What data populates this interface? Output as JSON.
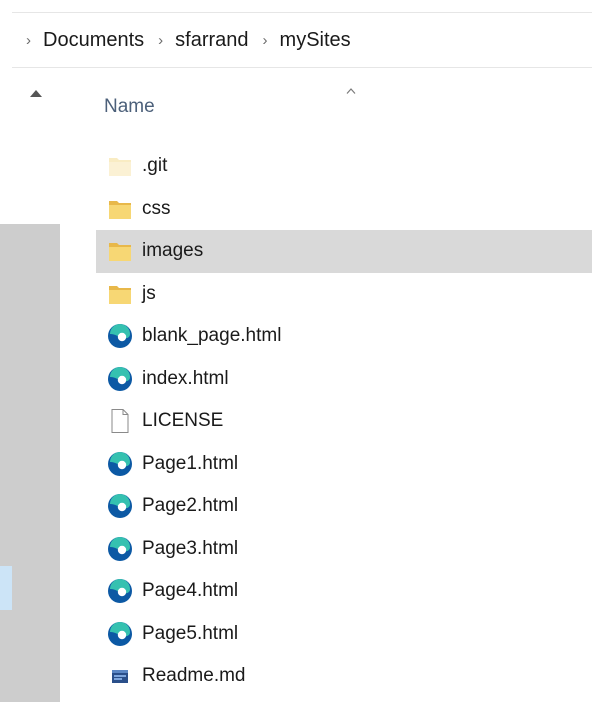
{
  "breadcrumb": {
    "items": [
      "Documents",
      "sfarrand",
      "mySites"
    ]
  },
  "header": {
    "name_label": "Name",
    "sort": "ascending"
  },
  "files": [
    {
      "name": ".git",
      "type": "folder-hidden"
    },
    {
      "name": "css",
      "type": "folder"
    },
    {
      "name": "images",
      "type": "folder",
      "selected": true
    },
    {
      "name": "js",
      "type": "folder"
    },
    {
      "name": "blank_page.html",
      "type": "edge-html"
    },
    {
      "name": "index.html",
      "type": "edge-html"
    },
    {
      "name": "LICENSE",
      "type": "file"
    },
    {
      "name": "Page1.html",
      "type": "edge-html"
    },
    {
      "name": "Page2.html",
      "type": "edge-html"
    },
    {
      "name": "Page3.html",
      "type": "edge-html"
    },
    {
      "name": "Page4.html",
      "type": "edge-html"
    },
    {
      "name": "Page5.html",
      "type": "edge-html"
    },
    {
      "name": "Readme.md",
      "type": "md-file"
    }
  ],
  "colors": {
    "selected_row": "#d9d9d9",
    "folder": "#f7d774",
    "edge_blue": "#0c59a4",
    "edge_teal": "#35c1b0"
  }
}
